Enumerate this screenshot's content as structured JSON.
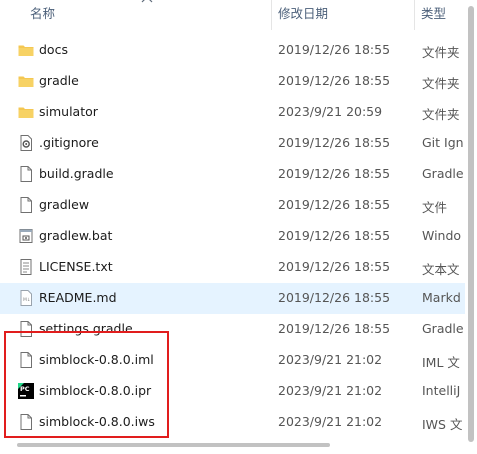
{
  "header": {
    "name_col": "名称",
    "date_col": "修改日期",
    "type_col": "类型"
  },
  "files": [
    {
      "name": "docs",
      "date": "2019/12/26 18:55",
      "type": "文件夹",
      "icon": "folder-icon"
    },
    {
      "name": "gradle",
      "date": "2019/12/26 18:55",
      "type": "文件夹",
      "icon": "folder-icon"
    },
    {
      "name": "simulator",
      "date": "2023/9/21 20:59",
      "type": "文件夹",
      "icon": "folder-icon"
    },
    {
      "name": ".gitignore",
      "date": "2019/12/26 18:55",
      "type": "Git Ign",
      "icon": "gear-file-icon"
    },
    {
      "name": "build.gradle",
      "date": "2019/12/26 18:55",
      "type": "Gradle",
      "icon": "file-icon"
    },
    {
      "name": "gradlew",
      "date": "2019/12/26 18:55",
      "type": "文件",
      "icon": "file-icon"
    },
    {
      "name": "gradlew.bat",
      "date": "2019/12/26 18:55",
      "type": "Windo",
      "icon": "bat-file-icon"
    },
    {
      "name": "LICENSE.txt",
      "date": "2019/12/26 18:55",
      "type": "文本文",
      "icon": "text-file-icon"
    },
    {
      "name": "README.md",
      "date": "2019/12/26 18:55",
      "type": "Markd",
      "icon": "md-file-icon"
    },
    {
      "name": "settings.gradle",
      "date": "2019/12/26 18:55",
      "type": "Gradle",
      "icon": "file-icon"
    },
    {
      "name": "simblock-0.8.0.iml",
      "date": "2023/9/21 21:02",
      "type": "IML 文",
      "icon": "file-icon"
    },
    {
      "name": "simblock-0.8.0.ipr",
      "date": "2023/9/21 21:02",
      "type": "IntelliJ",
      "icon": "pycharm-icon"
    },
    {
      "name": "simblock-0.8.0.iws",
      "date": "2023/9/21 21:02",
      "type": "IWS 文",
      "icon": "file-icon"
    }
  ],
  "selected_row": "README.md",
  "colors": {
    "selection": "#e5f3ff",
    "highlight_border": "#e11d1d",
    "folder": "#f4c752"
  }
}
